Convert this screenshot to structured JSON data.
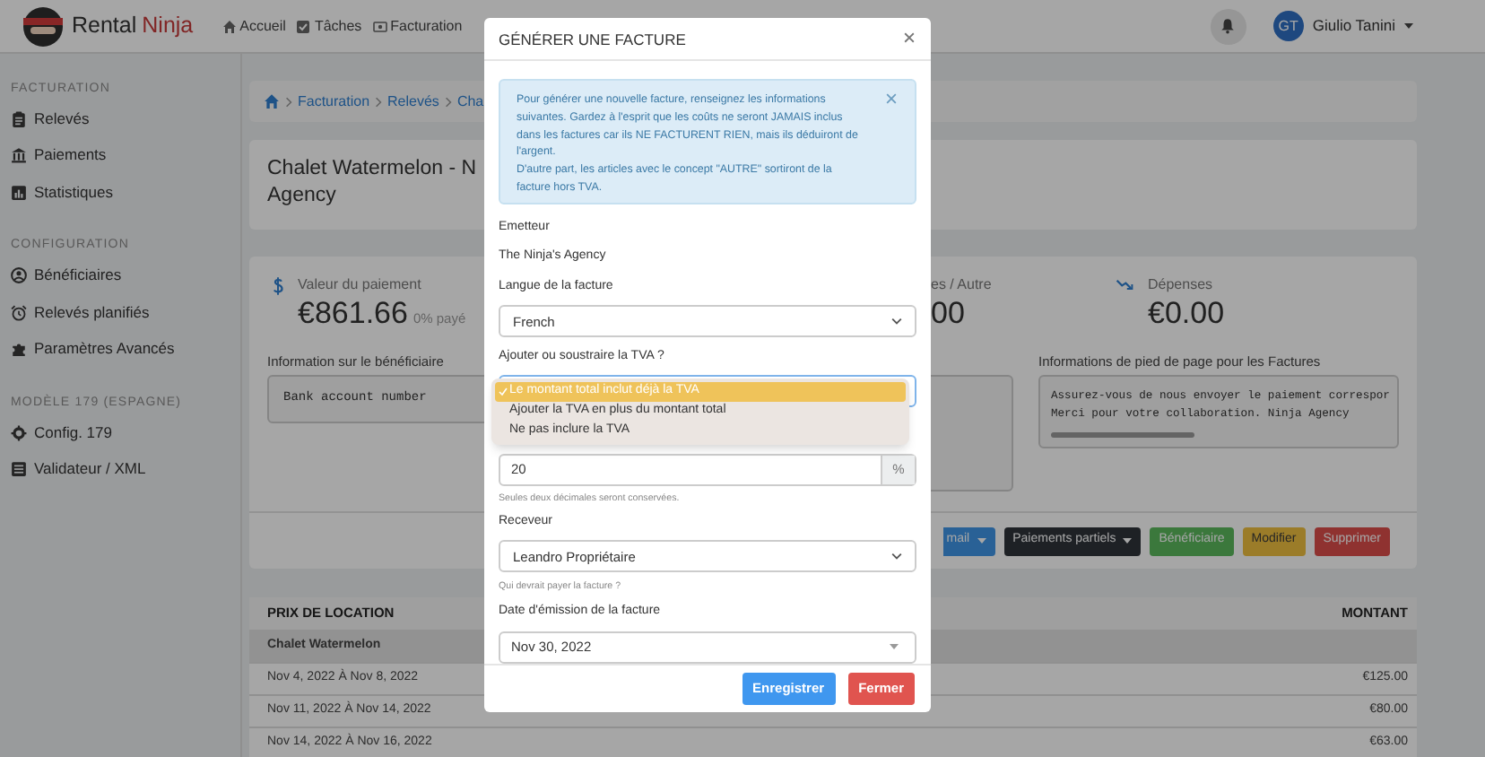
{
  "navbar": {
    "brand_dark": "Rental",
    "brand_accent": "Ninja",
    "items": [
      {
        "label": "Accueil"
      },
      {
        "label": "Tâches"
      },
      {
        "label": "Facturation"
      }
    ],
    "user": {
      "initials": "GT",
      "name": "Giulio Tanini"
    }
  },
  "sidebar": [
    {
      "heading": "FACTURATION",
      "items": [
        "Relevés",
        "Paiements",
        "Statistiques"
      ]
    },
    {
      "heading": "CONFIGURATION",
      "items": [
        "Bénéficiaires",
        "Relevés planifiés",
        "Paramètres Avancés"
      ]
    },
    {
      "heading": "MODÈLE 179 (ESPAGNE)",
      "items": [
        "Config. 179",
        "Validateur / XML"
      ]
    }
  ],
  "breadcrumb": [
    "Facturation",
    "Relevés",
    "Cha"
  ],
  "title_lines": [
    "Chalet Watermelon - N",
    "Agency"
  ],
  "summary": {
    "payment": {
      "label": "Valeur du paiement",
      "value": "€861.66",
      "note": "0% payé"
    },
    "other": {
      "label": "es / Autre",
      "value": "00"
    },
    "expenses": {
      "label": "Dépenses",
      "value": "€0.00"
    }
  },
  "beneficiary_info": {
    "label": "Information sur le bénéficiaire",
    "text": "Bank account number"
  },
  "footer_info": {
    "label": "Informations de pied de page pour les Factures",
    "lines": [
      "Assurez-vous de nous envoyer le paiement correspor",
      "Merci pour votre collaboration. Ninja Agency"
    ]
  },
  "actions": [
    {
      "label": "mail",
      "kind": "primary",
      "dropdown": true
    },
    {
      "label": "Paiements partiels",
      "kind": "dark",
      "dropdown": true
    },
    {
      "label": "Bénéficiaire",
      "kind": "success",
      "dropdown": false
    },
    {
      "label": "Modifier",
      "kind": "warning",
      "dropdown": false
    },
    {
      "label": "Supprimer",
      "kind": "danger",
      "dropdown": false
    }
  ],
  "table": {
    "columns": [
      "PRIX DE LOCATION",
      "MONTANT"
    ],
    "group": "Chalet Watermelon",
    "rows": [
      {
        "period": "Nov 4, 2022 À Nov 8, 2022",
        "amount": "€125.00"
      },
      {
        "period": "Nov 11, 2022 À Nov 14, 2022",
        "amount": "€80.00"
      },
      {
        "period": "Nov 14, 2022 À Nov 16, 2022",
        "amount": "€63.00"
      }
    ]
  },
  "modal": {
    "title": "GÉNÉRER UNE FACTURE",
    "alert": [
      "Pour générer une nouvelle facture, renseignez les informations suivantes. Gardez à l'esprit que les coûts ne seront JAMAIS inclus dans les factures car ils NE FACTURENT RIEN, mais ils déduiront de l'argent.",
      "D'autre part, les articles avec le concept \"AUTRE\" sortiront de la facture hors TVA."
    ],
    "issuer_label": "Emetteur",
    "issuer": "The Ninja's Agency",
    "language": {
      "label": "Langue de la facture",
      "value": "French"
    },
    "vat_mode": {
      "label": "Ajouter ou soustraire la TVA ?",
      "options": [
        {
          "label": "Le montant total inclut déjà la TVA",
          "selected": true
        },
        {
          "label": "Ajouter la TVA en plus du montant total",
          "selected": false
        },
        {
          "label": "Ne pas inclure la TVA",
          "selected": false
        }
      ]
    },
    "vat_rate": {
      "value": "20",
      "unit": "%",
      "help": "Seules deux décimales seront conservées."
    },
    "recipient": {
      "label": "Receveur",
      "value": "Leandro Propriétaire",
      "help": "Qui devrait payer la facture ?"
    },
    "issue_date": {
      "label": "Date d'émission de la facture",
      "value": "Nov 30, 2022"
    },
    "buttons": [
      {
        "label": "Enregistrer",
        "kind": "primary"
      },
      {
        "label": "Fermer",
        "kind": "danger"
      }
    ]
  }
}
